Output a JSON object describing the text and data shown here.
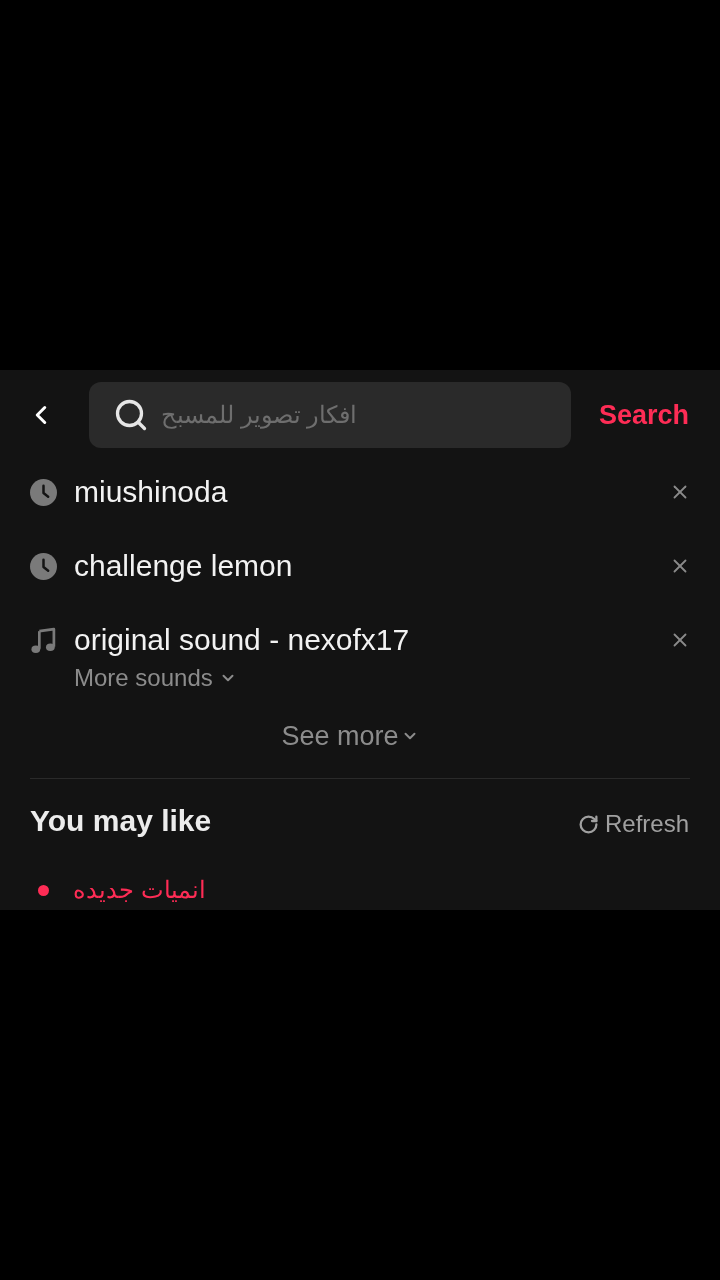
{
  "header": {
    "search_field": {
      "placeholder": "افكار تصوير للمسبح"
    },
    "search_button": "Search"
  },
  "history": [
    {
      "kind": "history",
      "text": "miushinoda"
    },
    {
      "kind": "history",
      "text": "challenge lemon"
    },
    {
      "kind": "sound",
      "text": "original sound - nexofx17",
      "more": "More sounds"
    }
  ],
  "see_more": "See more",
  "you_may_like": {
    "title": "You may like",
    "refresh": "Refresh",
    "items": [
      {
        "text": "انميات جديده",
        "color": "#fe2c55"
      }
    ]
  }
}
